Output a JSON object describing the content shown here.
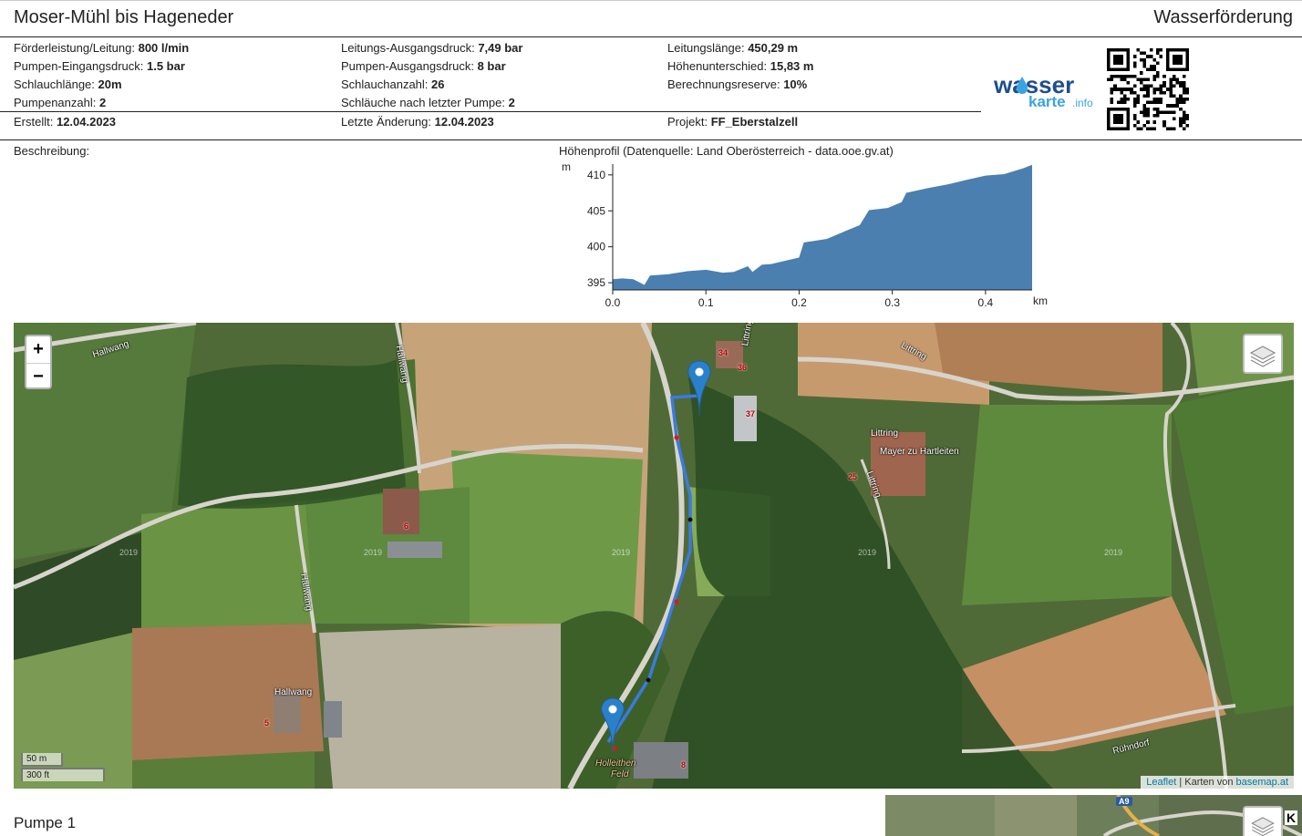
{
  "header": {
    "title": "Moser-Mühl bis Hageneder",
    "right_title": "Wasserförderung"
  },
  "info": {
    "col1": [
      {
        "label": "Förderleistung/Leitung: ",
        "value": "800 l/min"
      },
      {
        "label": "Pumpen-Eingangsdruck: ",
        "value": "1.5 bar"
      },
      {
        "label": "Schlauchlänge: ",
        "value": "20m"
      },
      {
        "label": "Pumpenanzahl: ",
        "value": "2"
      }
    ],
    "col2": [
      {
        "label": "Leitungs-Ausgangsdruck: ",
        "value": "7,49 bar"
      },
      {
        "label": "Pumpen-Ausgangsdruck: ",
        "value": "8 bar"
      },
      {
        "label": "Schlauchanzahl: ",
        "value": "26"
      },
      {
        "label": "Schläuche nach letzter Pumpe: ",
        "value": "2"
      }
    ],
    "col3": [
      {
        "label": "Leitungslänge: ",
        "value": "450,29 m"
      },
      {
        "label": "Höhenunterschied: ",
        "value": "15,83 m"
      },
      {
        "label": "Berechnungsreserve: ",
        "value": "10%"
      }
    ],
    "footer": [
      {
        "label": "Erstellt: ",
        "value": "12.04.2023"
      },
      {
        "label": "Letzte Änderung: ",
        "value": "12.04.2023"
      },
      {
        "label": "Projekt: ",
        "value": "FF_Eberstalzell"
      }
    ]
  },
  "logo": {
    "part1": "wasser",
    "part2": "karte",
    "part3": ".info"
  },
  "description": {
    "label": "Beschreibung:"
  },
  "profile": {
    "label": "Höhenprofil (Datenquelle: Land Oberösterreich - data.ooe.gv.at)",
    "y_unit": "m",
    "x_unit": "km"
  },
  "chart_data": {
    "type": "area",
    "xlabel": "km",
    "ylabel": "m",
    "xlim": [
      0,
      0.45
    ],
    "ylim": [
      394,
      411.5
    ],
    "x_ticks": [
      "0.0",
      "0.1",
      "0.2",
      "0.3",
      "0.4"
    ],
    "y_ticks": [
      "395",
      "400",
      "405",
      "410"
    ],
    "x": [
      0,
      0.01,
      0.022,
      0.034,
      0.04,
      0.06,
      0.08,
      0.1,
      0.118,
      0.13,
      0.145,
      0.15,
      0.16,
      0.17,
      0.2,
      0.205,
      0.23,
      0.25,
      0.265,
      0.275,
      0.295,
      0.31,
      0.315,
      0.34,
      0.36,
      0.38,
      0.4,
      0.42,
      0.44,
      0.45
    ],
    "values": [
      395.5,
      395.6,
      395.5,
      394.7,
      396.0,
      396.2,
      396.6,
      396.8,
      396.4,
      396.5,
      397.3,
      396.5,
      397.5,
      397.6,
      398.5,
      400.6,
      401.1,
      402.2,
      403.0,
      405.1,
      405.4,
      406.2,
      407.5,
      408.2,
      408.7,
      409.3,
      409.9,
      410.1,
      410.9,
      411.4
    ],
    "color": "#4a7fb0",
    "grid": false
  },
  "map": {
    "zoom_in": "+",
    "zoom_out": "−",
    "scale_m": "50 m",
    "scale_ft": "300 ft",
    "attribution_leaflet": "Leaflet",
    "attribution_sep": " | Karten von ",
    "attribution_basemap": "basemap.at",
    "labels": {
      "hallwang1": "Hallwang",
      "hallwang2": "Hallwang",
      "hallwang3": "Hallwang",
      "hallwang4": "Hallwang",
      "littring1": "Littring",
      "littring2": "Littring",
      "littring3": "Littring",
      "littring4": "Littring",
      "mayer": "Mayer zu Hartleiten",
      "holleithen": "Holleithen",
      "feld": "Feld",
      "ruehndorf": "Rühndorf"
    },
    "house_numbers": [
      "34",
      "36",
      "37",
      "25",
      "6",
      "5",
      "8"
    ],
    "years": [
      "2019",
      "2019",
      "2019",
      "2019",
      "2019"
    ],
    "line_color": "#3a7be0",
    "marker_color": "#2a81cb"
  },
  "section": {
    "title": "Pumpe 1"
  },
  "mini_map": {
    "road": "A9",
    "edge_letter": "K"
  }
}
